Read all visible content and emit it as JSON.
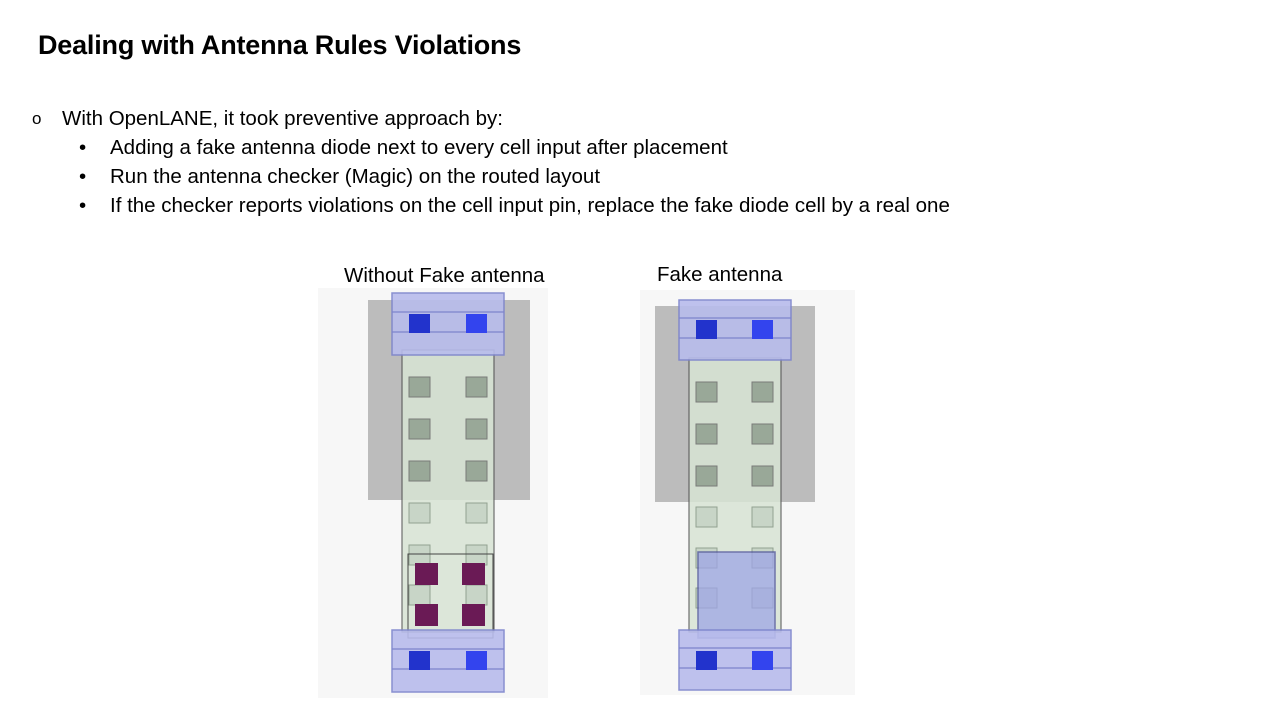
{
  "slide": {
    "title": "Dealing with Antenna Rules Violations",
    "bullet": {
      "marker": "o",
      "text": "With OpenLANE, it took preventive approach by:",
      "sub_marker": "•",
      "sub_items": [
        "Adding a fake antenna diode next to every cell input after placement",
        "Run the antenna checker (Magic) on the routed layout",
        "If the checker reports violations on the cell input pin, replace the fake diode cell by a real one"
      ]
    },
    "figures": [
      {
        "caption": "Without Fake antenna"
      },
      {
        "caption": "Fake antenna"
      }
    ],
    "colors": {
      "contact_blue": "#2233cc",
      "rail_blue": "#b8bcec",
      "contact_purple": "#6a1a55",
      "overlay_gray": "#a8a8a8",
      "diff_green": "#d8e4d4"
    }
  }
}
